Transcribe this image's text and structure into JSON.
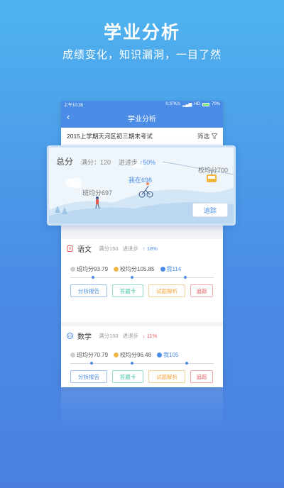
{
  "promo": {
    "title": "学业分析",
    "subtitle": "成绩变化，知识漏洞，一目了然"
  },
  "status_bar": {
    "time": "上午10:35",
    "speed": "0.37K/s",
    "network": "HD",
    "battery": "70%"
  },
  "nav": {
    "title": "学业分析"
  },
  "exam": {
    "name": "2015上学期天河区初三期末考试",
    "filter_label": "筛选"
  },
  "overview": {
    "label": "总分",
    "full_score": "满分：120",
    "progress_label": "进进步",
    "progress_value": "↑50%",
    "school_avg": "校均分700",
    "my_score": "我在698",
    "class_avg": "班均分697",
    "track_button": "追踪"
  },
  "subjects": [
    {
      "name": "语文",
      "full_score": "满分150",
      "progress_label": "进进步",
      "progress_value": "↑ 18%",
      "direction": "up",
      "class_avg": "班均分93.79",
      "school_avg": "校均分105.85",
      "my_score": "我114",
      "icon": "book-icon",
      "icon_color": "#e4595a"
    },
    {
      "name": "数学",
      "full_score": "满分150",
      "progress_label": "进退步",
      "progress_value": "↓ 11%",
      "direction": "down",
      "class_avg": "班均分70.79",
      "school_avg": "校均分96.48",
      "my_score": "我105",
      "icon": "math-icon",
      "icon_color": "#4b8de6"
    }
  ],
  "buttons": {
    "report": "分析报告",
    "answer_card": "答题卡",
    "analysis": "试题解析",
    "track": "追踪"
  },
  "colors": {
    "primary": "#4b8de6",
    "report": "#4b8de6",
    "answer_card": "#3fbfa5",
    "analysis": "#f0a640",
    "track": "#e4595a"
  }
}
